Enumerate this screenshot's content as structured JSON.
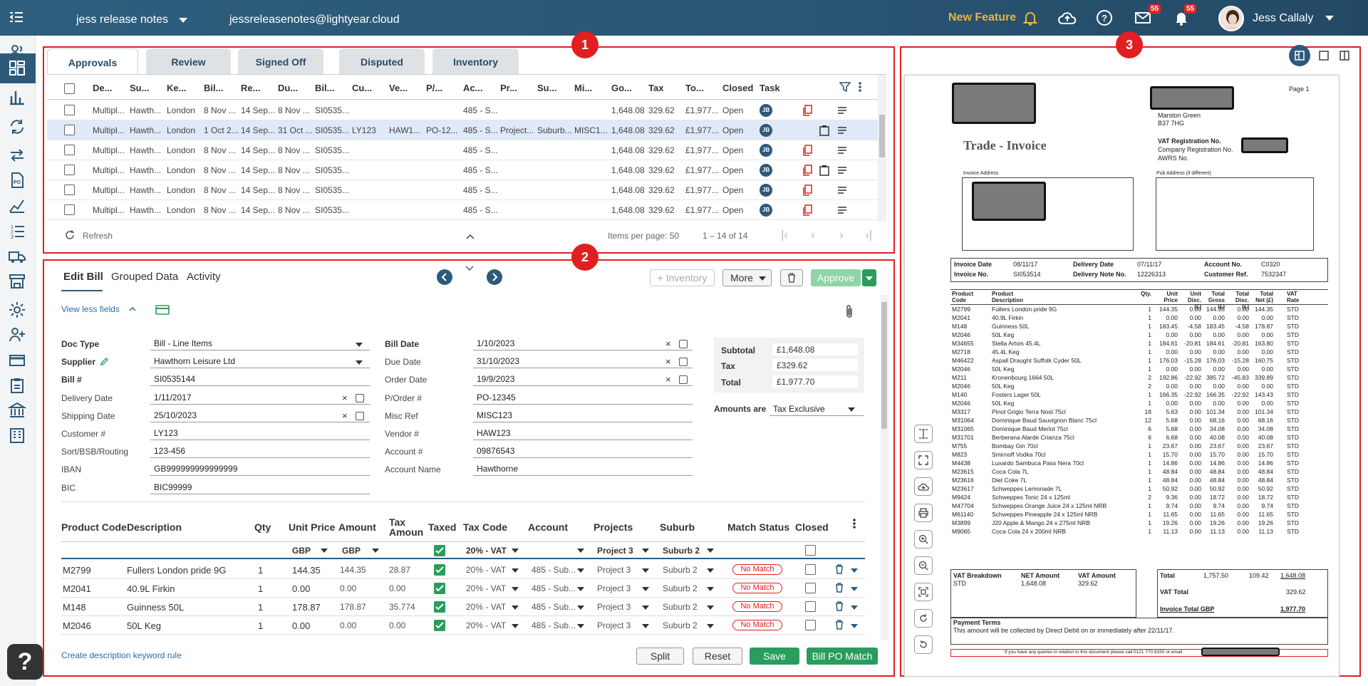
{
  "header": {
    "org": "jess release notes",
    "email": "jessreleasenotes@lightyear.cloud",
    "new_feature": "New Feature",
    "mail_count": "55",
    "notif_count": "55",
    "user": "Jess Callaly"
  },
  "panel_numbers": [
    "1",
    "2",
    "3"
  ],
  "tabs": [
    "Approvals",
    "Review",
    "Signed Off",
    "Disputed",
    "Inventory"
  ],
  "grid": {
    "columns": [
      "De...",
      "Su...",
      "Ke...",
      "Bil...",
      "Re...",
      "Du...",
      "Bil...",
      "Cu...",
      "Ve...",
      "P/...",
      "Ac...",
      "Pr...",
      "Su...",
      "Mi...",
      "Go...",
      "Tax",
      "To...",
      "Closed",
      "Task"
    ],
    "rows": [
      {
        "de": "Multipl...",
        "su": "Hawth...",
        "ke": "London",
        "bil": "8 Nov ...",
        "re": "14 Sep...",
        "du": "8 Nov ...",
        "bill": "SI0535...",
        "cu": "",
        "ve": "",
        "po": "",
        "ac": "485 - S...",
        "pr": "",
        "sub": "",
        "mi": "",
        "go": "1,648.08",
        "tax": "329.62",
        "to": "£1,977...",
        "closed": "Open",
        "task": "JB"
      },
      {
        "de": "Multipl...",
        "su": "Hawth...",
        "ke": "London",
        "bil": "1 Oct 2...",
        "re": "14 Sep...",
        "du": "31 Oct ...",
        "bill": "SI0535...",
        "cu": "LY123",
        "ve": "HAW1...",
        "po": "PO-12...",
        "ac": "485 - S...",
        "pr": "Project...",
        "sub": "Suburb...",
        "mi": "MISC1...",
        "go": "1,648.08",
        "tax": "329.62",
        "to": "£1,977...",
        "closed": "Open",
        "task": "JB"
      },
      {
        "de": "Multipl...",
        "su": "Hawth...",
        "ke": "London",
        "bil": "8 Nov ...",
        "re": "14 Sep...",
        "du": "8 Nov ...",
        "bill": "SI0535...",
        "cu": "",
        "ve": "",
        "po": "",
        "ac": "485 - S...",
        "pr": "",
        "sub": "",
        "mi": "",
        "go": "1,648.08",
        "tax": "329.62",
        "to": "£1,977...",
        "closed": "Open",
        "task": "JB"
      },
      {
        "de": "Multipl...",
        "su": "Hawth...",
        "ke": "London",
        "bil": "8 Nov ...",
        "re": "14 Sep...",
        "du": "8 Nov ...",
        "bill": "SI0535...",
        "cu": "",
        "ve": "",
        "po": "",
        "ac": "485 - S...",
        "pr": "",
        "sub": "",
        "mi": "",
        "go": "1,648.08",
        "tax": "329.62",
        "to": "£1,977...",
        "closed": "Open",
        "task": "JB"
      },
      {
        "de": "Multipl...",
        "su": "Hawth...",
        "ke": "London",
        "bil": "8 Nov ...",
        "re": "14 Sep...",
        "du": "8 Nov ...",
        "bill": "SI0535...",
        "cu": "",
        "ve": "",
        "po": "",
        "ac": "485 - S...",
        "pr": "",
        "sub": "",
        "mi": "",
        "go": "1,648.08",
        "tax": "329.62",
        "to": "£1,977...",
        "closed": "Open",
        "task": "JB"
      },
      {
        "de": "Multipl...",
        "su": "Hawth...",
        "ke": "London",
        "bil": "8 Nov ...",
        "re": "14 Sep...",
        "du": "8 Nov ...",
        "bill": "SI0535...",
        "cu": "",
        "ve": "",
        "po": "",
        "ac": "485 - S...",
        "pr": "",
        "sub": "",
        "mi": "",
        "go": "1,648.08",
        "tax": "329.62",
        "to": "£1,977...",
        "closed": "Open",
        "task": "JB"
      }
    ],
    "refresh": "Refresh",
    "items_per_page": "Items per page: 50",
    "range": "1 – 14 of 14"
  },
  "edit": {
    "tabs": [
      "Edit Bill",
      "Grouped Data",
      "Activity"
    ],
    "inventory_btn": "Inventory",
    "more_btn": "More",
    "approve_btn": "Approve",
    "view_less": "View less fields",
    "fields_left": [
      {
        "label": "Doc Type",
        "value": "Bill - Line Items",
        "bold": true
      },
      {
        "label": "Supplier",
        "value": "Hawthorn Leisure Ltd",
        "bold": true
      },
      {
        "label": "Bill #",
        "value": "SI0535144",
        "bold": true
      },
      {
        "label": "Delivery Date",
        "value": "1/11/2017",
        "bold": false
      },
      {
        "label": "Shipping Date",
        "value": "25/10/2023",
        "bold": false
      },
      {
        "label": "Customer #",
        "value": "LY123",
        "bold": false
      },
      {
        "label": "Sort/BSB/Routing",
        "value": "123-456",
        "bold": false
      },
      {
        "label": "IBAN",
        "value": "GB999999999999999",
        "bold": false
      },
      {
        "label": "BIC",
        "value": "BIC99999",
        "bold": false
      }
    ],
    "fields_mid": [
      {
        "label": "Bill Date",
        "value": "1/10/2023",
        "bold": true
      },
      {
        "label": "Due Date",
        "value": "31/10/2023",
        "bold": false
      },
      {
        "label": "Order Date",
        "value": "19/9/2023",
        "bold": false
      },
      {
        "label": "P/Order #",
        "value": "PO-12345",
        "bold": false
      },
      {
        "label": "Misc Ref",
        "value": "MISC123",
        "bold": false
      },
      {
        "label": "Vendor #",
        "value": "HAW123",
        "bold": false
      },
      {
        "label": "Account #",
        "value": "09876543",
        "bold": false
      },
      {
        "label": "Account Name",
        "value": "Hawthorne",
        "bold": false
      }
    ],
    "totals": {
      "subtotal_label": "Subtotal",
      "subtotal": "£1,648.08",
      "tax_label": "Tax",
      "tax": "£329.62",
      "total_label": "Total",
      "total": "£1,977.70",
      "amounts_label": "Amounts are",
      "amounts": "Tax Exclusive"
    },
    "lines_header": [
      "Product Code",
      "Description",
      "Qty",
      "Unit Price",
      "Amount",
      "Tax Amoun",
      "Taxed",
      "Tax Code",
      "Account",
      "Projects",
      "Suburb",
      "Match Status",
      "Closed"
    ],
    "lines_filters": {
      "unit": "GBP",
      "amount": "GBP",
      "taxcode": "20% - VAT",
      "projects": "Project 3",
      "suburb": "Suburb 2"
    },
    "lines": [
      {
        "code": "M2799",
        "desc": "Fullers London pride 9G",
        "qty": "1",
        "unit": "144.35",
        "amount": "144.35",
        "tax": "28.87",
        "taxcode": "20% - VAT",
        "account": "485 - Sub...",
        "project": "Project 3",
        "suburb": "Suburb 2",
        "match": "No Match"
      },
      {
        "code": "M2041",
        "desc": "40.9L Firkin",
        "qty": "1",
        "unit": "0.00",
        "amount": "0.00",
        "tax": "0.00",
        "taxcode": "20% - VAT",
        "account": "485 - Sub...",
        "project": "Project 3",
        "suburb": "Suburb 2",
        "match": "No Match"
      },
      {
        "code": "M148",
        "desc": "Guinness  50L",
        "qty": "1",
        "unit": "178.87",
        "amount": "178.87",
        "tax": "35.774",
        "taxcode": "20% - VAT",
        "account": "485 - Sub...",
        "project": "Project 3",
        "suburb": "Suburb 2",
        "match": "No Match"
      },
      {
        "code": "M2046",
        "desc": "50L Keg",
        "qty": "1",
        "unit": "0.00",
        "amount": "0.00",
        "tax": "0.00",
        "taxcode": "20% - VAT",
        "account": "485 - Sub...",
        "project": "Project 3",
        "suburb": "Suburb 2",
        "match": "No Match"
      }
    ],
    "keyword_rule": "Create description keyword rule",
    "split": "Split",
    "reset": "Reset",
    "save": "Save",
    "bill_po": "Bill PO Match"
  },
  "doc": {
    "page": "Page  1",
    "addr1": "Marston Green",
    "addr2": "B37 7HG",
    "title": "Trade - Invoice",
    "vat_reg": "VAT Registration No.",
    "company_reg": "Company Registration No.",
    "awrs": "AWRS No.",
    "invoice_address": "Invoice Address",
    "pub_address": "Pub Address (if different)",
    "meta": [
      [
        "Invoice Date",
        "08/11/17",
        "Delivery Date",
        "07/11/17",
        "Account No.",
        "C0320"
      ],
      [
        "Invoice No.",
        "SI053514",
        "Delivery Note No.",
        "12226313",
        "Customer Ref.",
        "7532347"
      ]
    ],
    "prod_header": [
      "Product Code",
      "Product Description",
      "Qty.",
      "Unit Price",
      "Unit Disc. (£)",
      "Total Gross (£)",
      "Total Disc. (£)",
      "Total Net (£)",
      "VAT Rate"
    ],
    "products": [
      [
        "M2799",
        "Fullers London pride 9G",
        "1",
        "144.35",
        "0.00",
        "144.35",
        "0.00",
        "144.35",
        "STD"
      ],
      [
        "M2041",
        "40.9L Firkin",
        "1",
        "0.00",
        "0.00",
        "0.00",
        "0.00",
        "0.00",
        "STD"
      ],
      [
        "M148",
        "Guinness  50L",
        "1",
        "183.45",
        "-4.58",
        "183.45",
        "-4.58",
        "178.87",
        "STD"
      ],
      [
        "M2046",
        "50L Keg",
        "1",
        "0.00",
        "0.00",
        "0.00",
        "0.00",
        "0.00",
        "STD"
      ],
      [
        "M34655",
        "Stella Artois  45.4L",
        "1",
        "184.61",
        "-20.81",
        "184.61",
        "-20.81",
        "163.80",
        "STD"
      ],
      [
        "M2718",
        "45.4L Keg",
        "1",
        "0.00",
        "0.00",
        "0.00",
        "0.00",
        "0.00",
        "STD"
      ],
      [
        "M46422",
        "Aspall Draught Suffolk Cyder 50L",
        "1",
        "176.03",
        "-15.28",
        "176.03",
        "-15.28",
        "160.75",
        "STD"
      ],
      [
        "M2046",
        "50L Keg",
        "1",
        "0.00",
        "0.00",
        "0.00",
        "0.00",
        "0.00",
        "STD"
      ],
      [
        "M211",
        "Kronenbourg 1664  50L",
        "2",
        "192.86",
        "-22.92",
        "385.72",
        "-45.83",
        "339.89",
        "STD"
      ],
      [
        "M2046",
        "50L Keg",
        "2",
        "0.00",
        "0.00",
        "0.00",
        "0.00",
        "0.00",
        "STD"
      ],
      [
        "M140",
        "Fosters Lager  50L",
        "1",
        "166.35",
        "-22.92",
        "166.35",
        "-22.92",
        "143.43",
        "STD"
      ],
      [
        "M2046",
        "50L Keg",
        "1",
        "0.00",
        "0.00",
        "0.00",
        "0.00",
        "0.00",
        "STD"
      ],
      [
        "M3317",
        "Pinot Grigio Terra Nost  75cl",
        "18",
        "5.63",
        "0.00",
        "101.34",
        "0.00",
        "101.34",
        "STD"
      ],
      [
        "M31064",
        "Dominique Baud Sauvignon Blanc  75cl",
        "12",
        "5.68",
        "0.00",
        "68.16",
        "0.00",
        "68.16",
        "STD"
      ],
      [
        "M31065",
        "Dominique Baud Merlot  75cl",
        "6",
        "5.68",
        "0.00",
        "34.08",
        "0.00",
        "34.08",
        "STD"
      ],
      [
        "M31701",
        "Berberana Alarde Crianza  75cl",
        "6",
        "6.68",
        "0.00",
        "40.08",
        "0.00",
        "40.08",
        "STD"
      ],
      [
        "M755",
        "Bombay Gin  70cl",
        "1",
        "23.67",
        "0.00",
        "23.67",
        "0.00",
        "23.67",
        "STD"
      ],
      [
        "M823",
        "Smirnoff Vodka  70cl",
        "1",
        "15.70",
        "0.00",
        "15.70",
        "0.00",
        "15.70",
        "STD"
      ],
      [
        "M4438",
        "Luxardo Sambuca Pass Nera  70cl",
        "1",
        "14.86",
        "0.00",
        "14.86",
        "0.00",
        "14.86",
        "STD"
      ],
      [
        "M23615",
        "Coca Cola  7L",
        "1",
        "48.84",
        "0.00",
        "48.84",
        "0.00",
        "48.84",
        "STD"
      ],
      [
        "M23616",
        "Diet Coke  7L",
        "1",
        "48.84",
        "0.00",
        "48.84",
        "0.00",
        "48.84",
        "STD"
      ],
      [
        "M23617",
        "Schweppes Lemonade  7L",
        "1",
        "50.92",
        "0.00",
        "50.92",
        "0.00",
        "50.92",
        "STD"
      ],
      [
        "M9424",
        "Schweppes Tonic 24 x 125ml",
        "2",
        "9.36",
        "0.00",
        "18.72",
        "0.00",
        "18.72",
        "STD"
      ],
      [
        "M47704",
        "Schweppes Orange Juice  24 x 125ml NRB",
        "1",
        "9.74",
        "0.00",
        "9.74",
        "0.00",
        "9.74",
        "STD"
      ],
      [
        "M61140",
        "Schweppes Pineapple  24 x 125ml NRB",
        "1",
        "11.65",
        "0.00",
        "11.65",
        "0.00",
        "11.65",
        "STD"
      ],
      [
        "M3899",
        "J20 Apple & Mango  24 x 275ml NRB",
        "1",
        "19.26",
        "0.00",
        "19.26",
        "0.00",
        "19.26",
        "STD"
      ],
      [
        "M9065",
        "Coca Cola  24 x 200ml NRB",
        "1",
        "11.13",
        "0.00",
        "11.13",
        "0.00",
        "11.13",
        "STD"
      ]
    ],
    "vat_breakdown": "VAT Breakdown",
    "net_amount": "NET Amount",
    "vat_amount": "VAT Amount",
    "std": "STD",
    "std_net": "1,648.08",
    "std_vat": "329.62",
    "total_label": "Total",
    "total_gross": "1,757.50",
    "total_disc": "109.42",
    "total_net": "1,648.08",
    "vat_total_label": "VAT Total",
    "vat_total": "329.62",
    "invoice_total_label": "Invoice Total GBP",
    "invoice_total": "1,977.70",
    "payment_terms": "Payment Terms",
    "payment_text": "This amount will be collected by Direct Debit  on or immediately after 22/11/17.",
    "footer": "If you have any queries in relation to this document please call 0121 770 8150 or email"
  }
}
